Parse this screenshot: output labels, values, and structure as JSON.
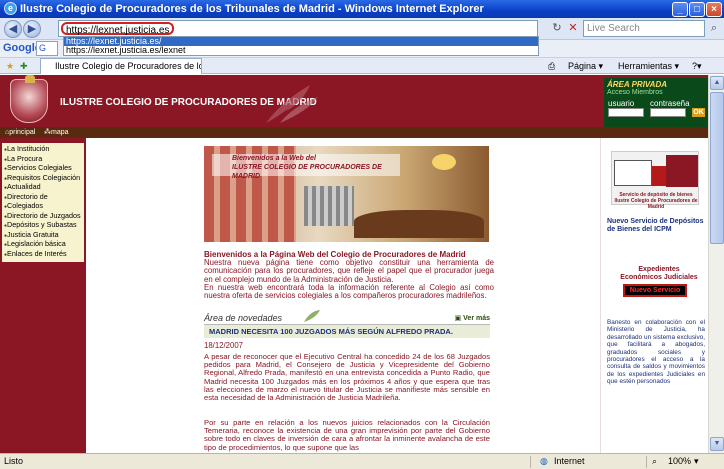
{
  "window": {
    "title": "Ilustre Colegio de Procuradores de los Tribunales de Madrid - Windows Internet Explorer"
  },
  "address_bar": {
    "value": "https://lexnet.justicia.es",
    "suggestions": [
      "https://lexnet.justicia.es/",
      "https://lexnet.justicia.es/lexnet"
    ],
    "live_search_placeholder": "Live Search"
  },
  "google_toolbar": {
    "label": "Google",
    "box": "G"
  },
  "tabs": {
    "active_tab": "Ilustre Colegio de Procuradores de los Trib...",
    "page_label": "Página",
    "tools_label": "Herramientas"
  },
  "site": {
    "header": "ILUSTRE COLEGIO DE PROCURADORES DE MADRID",
    "private_area": {
      "title": "ÁREA PRIVADA",
      "subtitle": "Acceso Miembros",
      "user_label": "usuario",
      "password_label": "contraseña",
      "ok": "OK"
    },
    "topbar": {
      "home": "principal",
      "sitemap": "mapa sitio"
    },
    "menu": [
      "La Institución",
      "La Procura",
      "Servicios Colegiales",
      "Requisitos Colegiación",
      "Actualidad",
      "Directorio de",
      "Colegiados",
      "Directorio de Juzgados",
      "Depósitos y Subastas",
      "Justicia Gratuita",
      "Legislación básica",
      "Enlaces de Interés"
    ],
    "photo_caption": [
      "Bienvenidos a la Web del",
      "ILUSTRE COLEGIO DE PROCURADORES DE MADRID"
    ],
    "welcome_title": "Bienvenidos a la Página Web del Colegio de Procuradores de Madrid",
    "welcome_body": "Nuestra nueva página tiene como objetivo constituir una herramienta de comunicación para los procuradores, que refleje el papel que el procurador juega en el complejo mundo de la Administración de Justicia.",
    "welcome_body2": "En nuestra web encontrará toda la información referente al Colegio así como nuestra oferta de servicios colegiales a los compañeros procuradores madrileños.",
    "news": {
      "section_title": "Área de novedades",
      "more": "Ver más",
      "headline": "MADRID NECESITA 100 JUZGADOS MÁS SEGÚN ALFREDO PRADA.",
      "date": "18/12/2007",
      "p1": "A pesar de reconocer que el Ejecutivo Central ha concedido 24 de los 68 Juzgados pedidos para Madrid, el Consejero de Justicia y Vicepresidente del Gobierno Regional, Alfredo Prada, manifestó en una entrevista concedida a Punto Radio, que Madrid necesita 100 Juzgados más en los próximos 4 años y que espera que tras las elecciones de marzo el nuevo titular de Justicia se manifieste más sensible en esta necesidad de la Administración de Justicia Madrileña.",
      "p2": "Por su parte en relación a los nuevos juicios relacionados con la Circulación Temeraria, reconoce la existencia de una gran imprevisión por parte del Gobierno sobre todo en claves de inversión de cara a afrontar la inminente avalancha de este tipo de procedimientos, lo que supone que las"
    },
    "right": {
      "truck_caption": "Servicio de depósito de bienes Ilustre Colegio de Procuradores de Madrid",
      "deposit_text": "Nuevo Servicio de Depósitos de Bienes del ICPM",
      "expedientes": "Expedientes Económicos Judiciales",
      "nuevo": "Nuevo Servicio",
      "banesto": "Banesto en colaboración con el Ministerio de Justicia, ha desarrollado un sistema exclusivo, que facilitará a abogados, graduados sociales y procuradores el acceso a la consulta de saldos y movimientos de los expedientes Judiciales en que estén personados"
    }
  },
  "status_bar": {
    "left": "Listo",
    "zone": "Internet",
    "zoom": "100%"
  },
  "colors": {
    "maroon": "#8b1724",
    "green": "#0a4a1a",
    "xp_blue": "#0a3fc6"
  }
}
